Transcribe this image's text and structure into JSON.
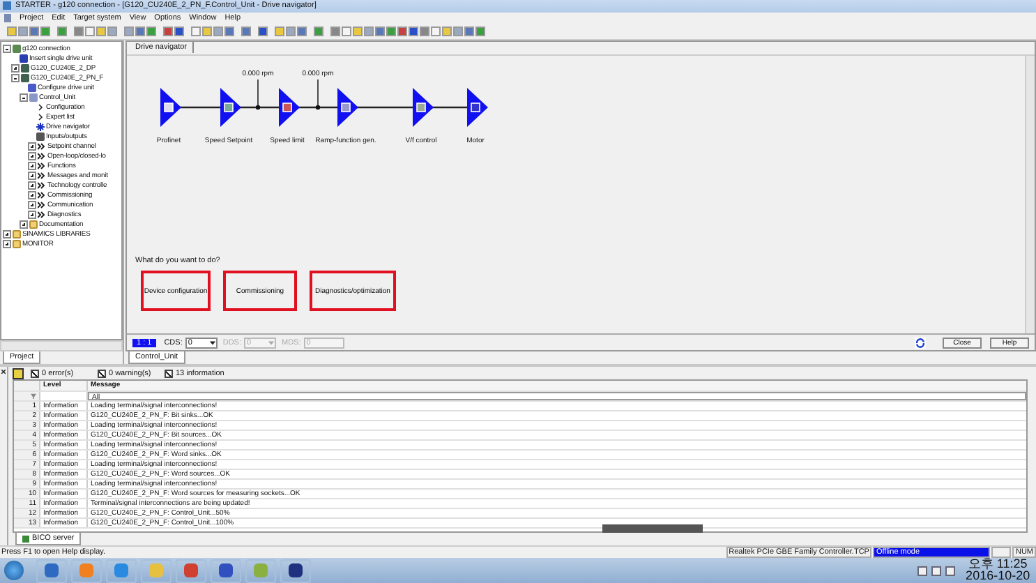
{
  "window": {
    "title": "STARTER - g120 connection - [G120_CU240E_2_PN_F.Control_Unit - Drive navigator]"
  },
  "menu": [
    "Project",
    "Edit",
    "Target system",
    "View",
    "Options",
    "Window",
    "Help"
  ],
  "tree": {
    "items": [
      {
        "label": "g120 connection",
        "kind": "project",
        "expanded": true,
        "children": [
          {
            "label": "Insert single drive unit",
            "kind": "insert"
          },
          {
            "label": "G120_CU240E_2_DP",
            "kind": "drive",
            "expanded": false
          },
          {
            "label": "G120_CU240E_2_PN_F",
            "kind": "drive",
            "expanded": true,
            "children": [
              {
                "label": "Configure drive unit",
                "kind": "config"
              },
              {
                "label": "Control_Unit",
                "kind": "unit",
                "expanded": true,
                "children": [
                  {
                    "label": "Configuration",
                    "kind": "page"
                  },
                  {
                    "label": "Expert list",
                    "kind": "page"
                  },
                  {
                    "label": "Drive navigator",
                    "kind": "nav"
                  },
                  {
                    "label": "Inputs/outputs",
                    "kind": "io"
                  },
                  {
                    "label": "Setpoint channel",
                    "kind": "group",
                    "expanded": false
                  },
                  {
                    "label": "Open-loop/closed-lo",
                    "kind": "group",
                    "expanded": false
                  },
                  {
                    "label": "Functions",
                    "kind": "group",
                    "expanded": false
                  },
                  {
                    "label": "Messages and monit",
                    "kind": "group",
                    "expanded": false
                  },
                  {
                    "label": "Technology controlle",
                    "kind": "group",
                    "expanded": false
                  },
                  {
                    "label": "Commissioning",
                    "kind": "group",
                    "expanded": false
                  },
                  {
                    "label": "Communication",
                    "kind": "group",
                    "expanded": false
                  },
                  {
                    "label": "Diagnostics",
                    "kind": "group",
                    "expanded": false
                  }
                ]
              },
              {
                "label": "Documentation",
                "kind": "folder",
                "expanded": false
              }
            ]
          }
        ]
      },
      {
        "label": "SINAMICS LIBRARIES",
        "kind": "folder",
        "expanded": false
      },
      {
        "label": "MONITOR",
        "kind": "folder",
        "expanded": false
      }
    ],
    "tab": "Project"
  },
  "navigator": {
    "tab": "Drive navigator",
    "blocks": [
      {
        "label": "Profinet"
      },
      {
        "label": "Speed Setpoint"
      },
      {
        "label": "Speed limit"
      },
      {
        "label": "Ramp-function gen."
      },
      {
        "label": "V/f control"
      },
      {
        "label": "Motor"
      }
    ],
    "readings": [
      "0.000 rpm",
      "0.000 rpm"
    ],
    "question": "What do you want to do?",
    "actions": [
      "Device configuration",
      "Commissioning",
      "Diagnostics/optimization"
    ],
    "ratio": "1 : 1",
    "selectors": [
      {
        "label": "CDS:",
        "value": "0",
        "disabled": false,
        "kind": "select"
      },
      {
        "label": "DDS:",
        "value": "0",
        "disabled": true,
        "kind": "select"
      },
      {
        "label": "MDS:",
        "value": "0",
        "disabled": true,
        "kind": "field"
      }
    ],
    "buttons": [
      "Close",
      "Help"
    ],
    "bottom_tab": "Control_Unit"
  },
  "log": {
    "filters": [
      {
        "label": "0 error(s)",
        "checked": true
      },
      {
        "label": "0 warning(s)",
        "checked": true
      },
      {
        "label": "13 information",
        "checked": true
      }
    ],
    "columns": [
      "Level",
      "Message"
    ],
    "filter_value": "All",
    "rows": [
      {
        "no": "1",
        "level": "Information",
        "message": "Loading terminal/signal interconnections!"
      },
      {
        "no": "2",
        "level": "Information",
        "message": "G120_CU240E_2_PN_F: Bit sinks...OK"
      },
      {
        "no": "3",
        "level": "Information",
        "message": "Loading terminal/signal interconnections!"
      },
      {
        "no": "4",
        "level": "Information",
        "message": "G120_CU240E_2_PN_F: Bit sources...OK"
      },
      {
        "no": "5",
        "level": "Information",
        "message": "Loading terminal/signal interconnections!"
      },
      {
        "no": "6",
        "level": "Information",
        "message": "G120_CU240E_2_PN_F: Word sinks...OK"
      },
      {
        "no": "7",
        "level": "Information",
        "message": "Loading terminal/signal interconnections!"
      },
      {
        "no": "8",
        "level": "Information",
        "message": "G120_CU240E_2_PN_F: Word sources...OK"
      },
      {
        "no": "9",
        "level": "Information",
        "message": "Loading terminal/signal interconnections!"
      },
      {
        "no": "10",
        "level": "Information",
        "message": "G120_CU240E_2_PN_F: Word sources for measuring sockets...OK"
      },
      {
        "no": "11",
        "level": "Information",
        "message": "Terminal/signal interconnections are being updated!"
      },
      {
        "no": "12",
        "level": "Information",
        "message": "G120_CU240E_2_PN_F: Control_Unit...50%"
      },
      {
        "no": "13",
        "level": "Information",
        "message": "G120_CU240E_2_PN_F: Control_Unit...100%"
      }
    ],
    "tab": "BICO server"
  },
  "status_bar": {
    "hint": "Press F1 to open Help display.",
    "adapter": "Realtek PCIe GBE Family Controller.TCP",
    "mode": "Offline mode",
    "num": "NUM"
  },
  "taskbar": {
    "time": "오후 11:25",
    "date": "2016-10-20"
  }
}
